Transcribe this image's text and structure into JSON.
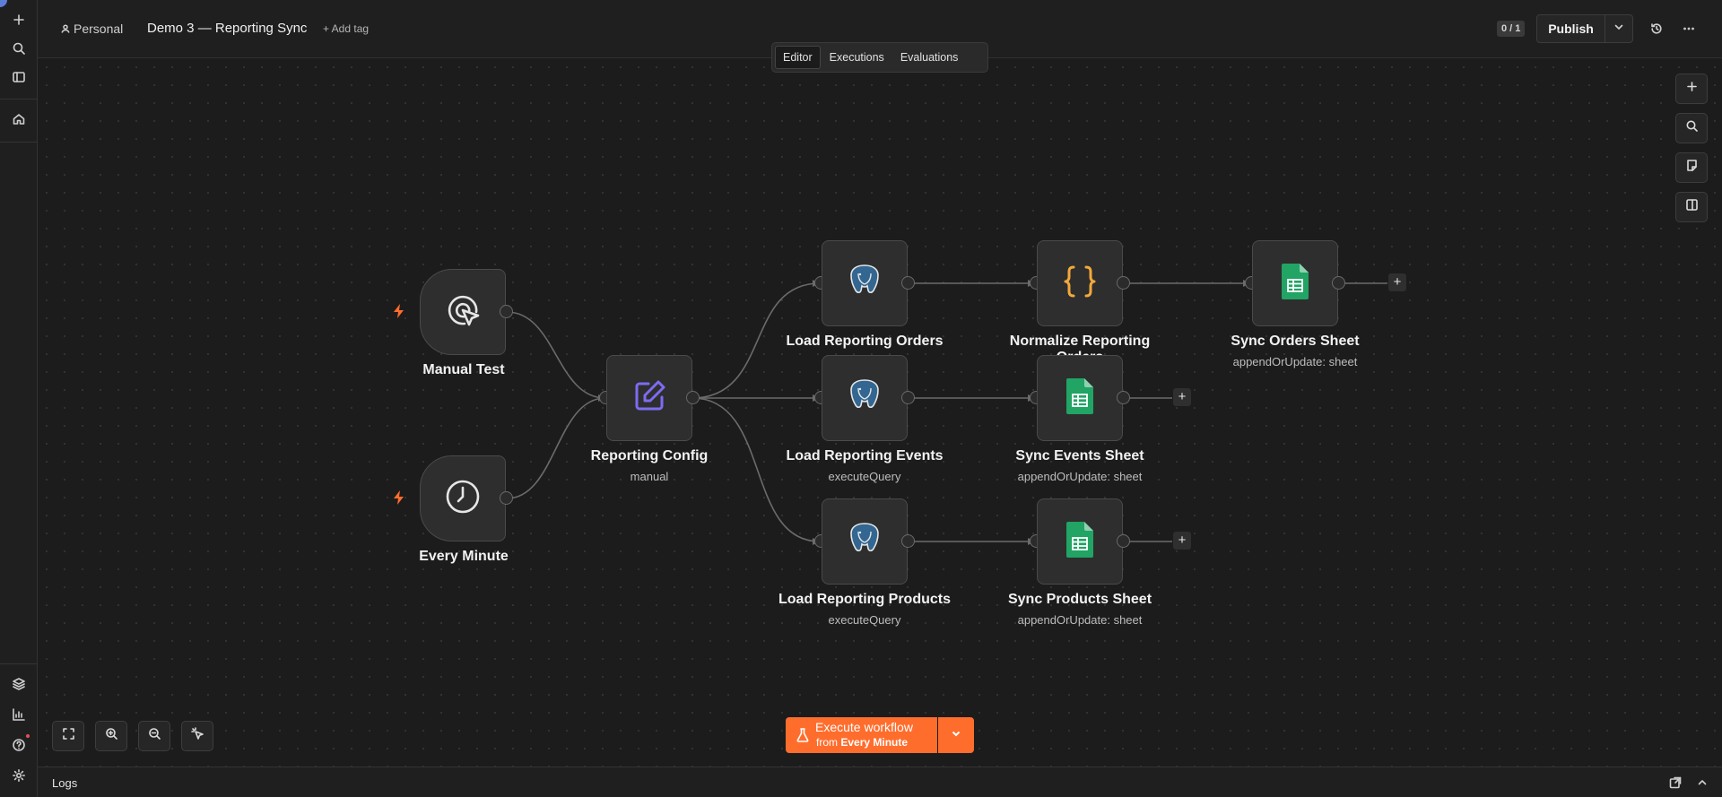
{
  "header": {
    "project": "Personal",
    "workflow_name": "Demo 3 — Reporting Sync",
    "add_tag": "+ Add tag",
    "counter": "0 / 1",
    "publish_label": "Publish"
  },
  "tabs": [
    {
      "label": "Editor",
      "active": true
    },
    {
      "label": "Executions",
      "active": false
    },
    {
      "label": "Evaluations",
      "active": false
    }
  ],
  "nodes": {
    "manual_test": {
      "title": "Manual Test",
      "icon": "cursor-click-icon"
    },
    "every_minute": {
      "title": "Every Minute",
      "icon": "clock-icon"
    },
    "reporting_config": {
      "title": "Reporting Config",
      "subtitle": "manual",
      "icon": "edit-icon"
    },
    "load_orders": {
      "title": "Load Reporting Orders",
      "icon": "postgres-icon"
    },
    "normalize_orders": {
      "title": "Normalize Reporting",
      "title_overflow": "Orders",
      "icon": "code-icon"
    },
    "sync_orders": {
      "title": "Sync Orders Sheet",
      "subtitle": "appendOrUpdate: sheet",
      "icon": "google-sheets-icon"
    },
    "load_events": {
      "title": "Load Reporting Events",
      "subtitle": "executeQuery",
      "icon": "postgres-icon"
    },
    "sync_events": {
      "title": "Sync Events Sheet",
      "subtitle": "appendOrUpdate: sheet",
      "icon": "google-sheets-icon"
    },
    "load_products": {
      "title": "Load Reporting Products",
      "subtitle": "executeQuery",
      "icon": "postgres-icon"
    },
    "sync_products": {
      "title": "Sync Products Sheet",
      "subtitle": "appendOrUpdate: sheet",
      "icon": "google-sheets-icon"
    }
  },
  "execute": {
    "label": "Execute workflow",
    "sub_prefix": "from ",
    "sub_trigger": "Every Minute"
  },
  "logs": {
    "label": "Logs"
  },
  "colors": {
    "accent": "#ff6d2d",
    "trigger_bolt": "#ff6d2d",
    "edit_icon": "#7c6cf2",
    "code_icon": "#f2a83b",
    "sheets_green": "#21a464",
    "postgres_blue": "#336791"
  }
}
